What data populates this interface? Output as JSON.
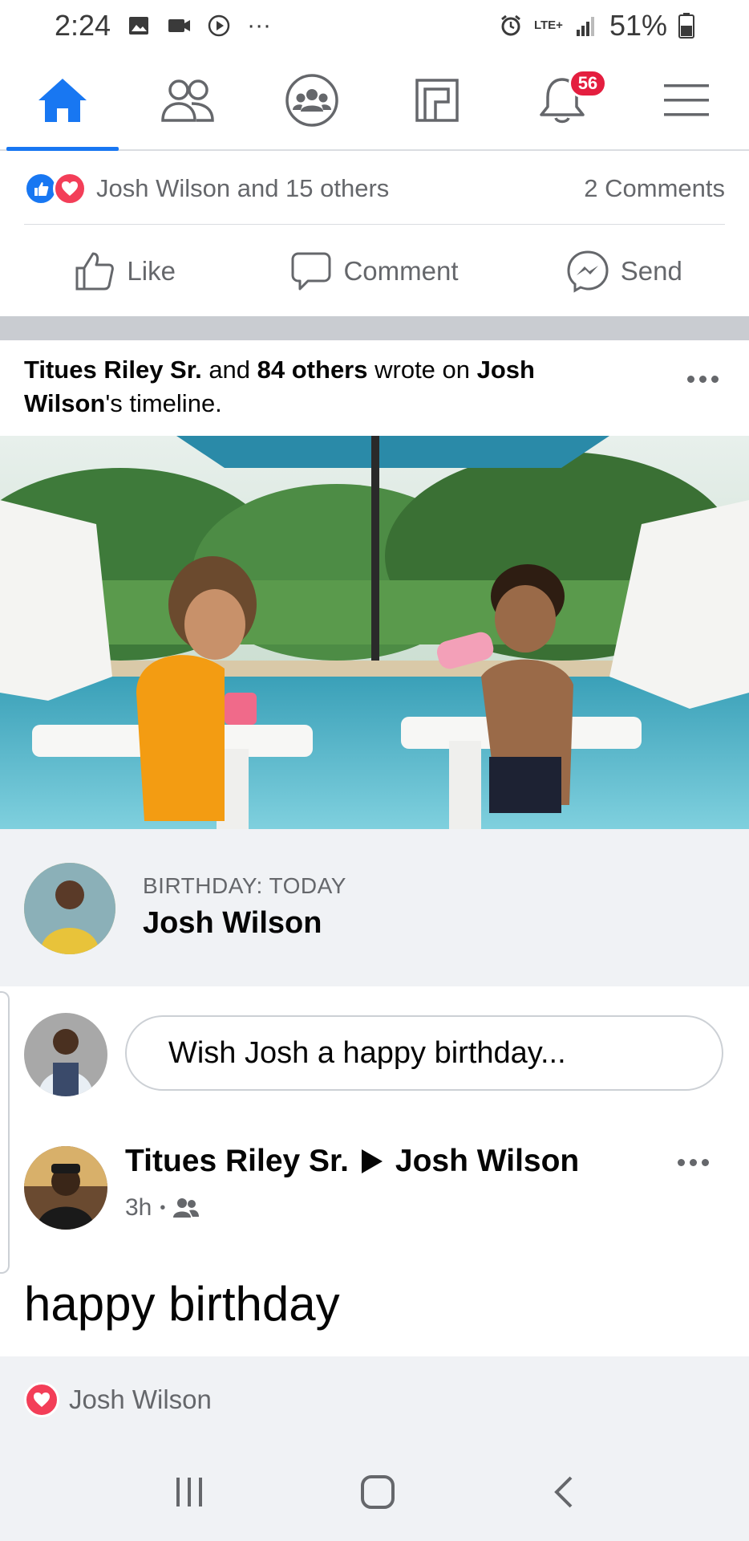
{
  "status_bar": {
    "time": "2:24",
    "network": "LTE+",
    "battery": "51%",
    "more": "···"
  },
  "top_nav": {
    "tabs": [
      "home",
      "friends",
      "groups",
      "pages",
      "notifications",
      "menu"
    ],
    "notification_count": "56",
    "active_tab": "home",
    "accent_color": "#1877f2"
  },
  "post1": {
    "reactions_text": "Josh Wilson and 15 others",
    "comments_text": "2 Comments",
    "actions": {
      "like": "Like",
      "comment": "Comment",
      "send": "Send"
    }
  },
  "group_post": {
    "author": "Titues Riley Sr.",
    "and_text": " and ",
    "others": "84 others",
    "wrote_text": " wrote on ",
    "target_first": "Josh",
    "target_last": "Wilson",
    "suffix": "'s timeline."
  },
  "birthday": {
    "label": "BIRTHDAY: TODAY",
    "name": "Josh Wilson"
  },
  "wish": {
    "placeholder": "Wish Josh a happy birthday..."
  },
  "post2": {
    "author": "Titues Riley Sr.",
    "target": "Josh Wilson",
    "time": "3h",
    "separator": "•",
    "text": "happy birthday",
    "reaction_name": "Josh Wilson"
  }
}
